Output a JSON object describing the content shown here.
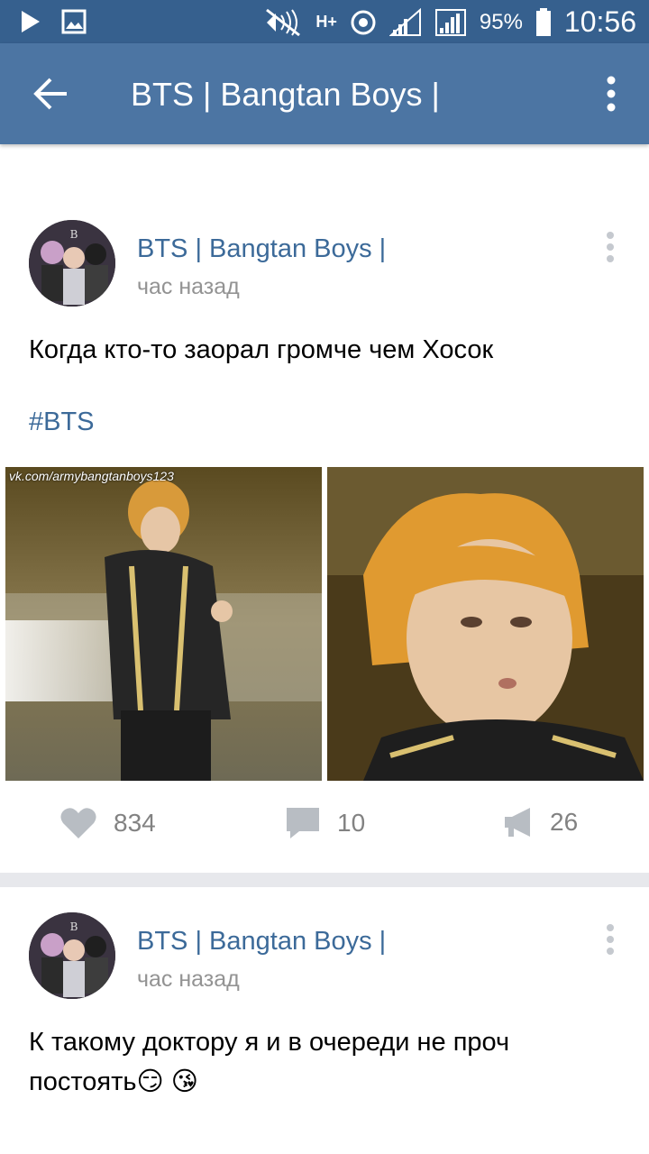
{
  "status_bar": {
    "battery_percent": "95%",
    "time": "10:56",
    "network": "H+"
  },
  "app_bar": {
    "title": "BTS | Bangtan Boys |"
  },
  "posts": [
    {
      "author": "BTS | Bangtan Boys |",
      "time": "час назад",
      "text": "Когда кто-то заорал громче чем Хосок",
      "hashtag": "#BTS",
      "watermark": "vk.com/armybangtanboys123",
      "likes": "834",
      "comments": "10",
      "reposts": "26"
    },
    {
      "author": "BTS | Bangtan Boys |",
      "time": "час назад",
      "text": "К такому доктору я и в очереди не проч постоять😏 😘"
    }
  ],
  "colors": {
    "status_bar": "#36608e",
    "app_bar": "#4c75a3",
    "link": "#3c6a99",
    "meta": "#939393",
    "action": "#828282"
  },
  "icons": [
    "play-icon",
    "image-icon",
    "mute-icon",
    "data-arrows-icon",
    "sync-icon",
    "signal-icon",
    "battery-icon",
    "back-arrow-icon",
    "more-vert-icon",
    "heart-icon",
    "comment-icon",
    "megaphone-icon"
  ]
}
